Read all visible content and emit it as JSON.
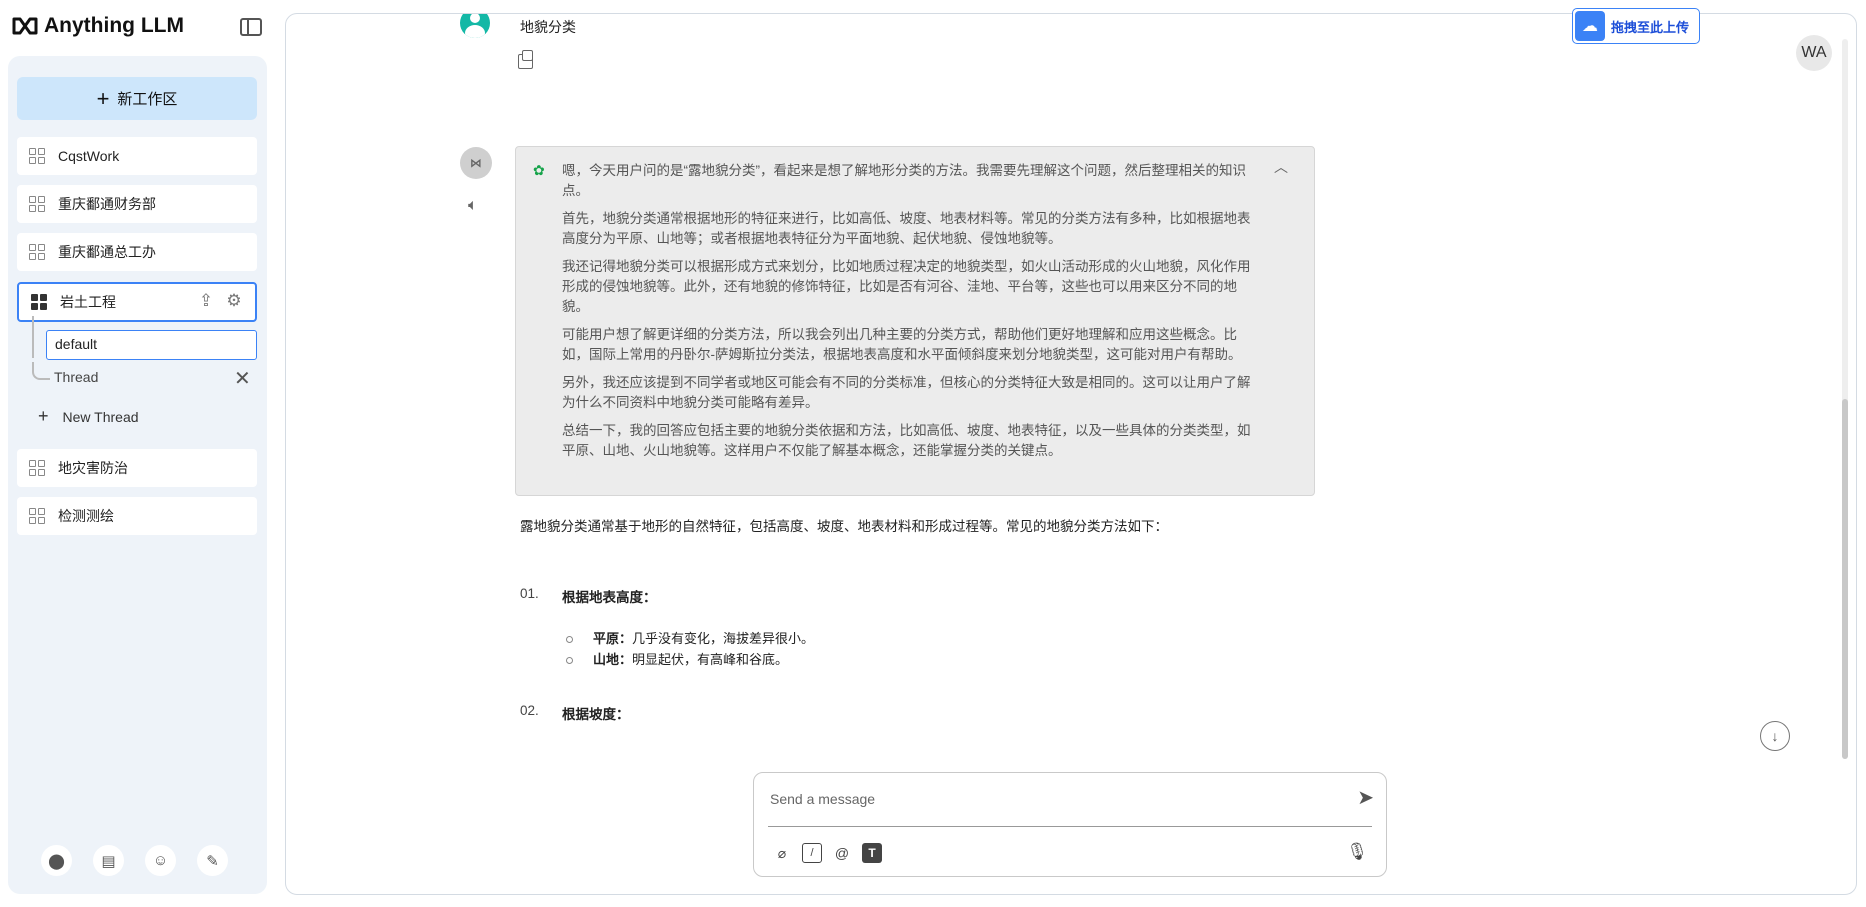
{
  "brand": {
    "name": "Anything LLM"
  },
  "sidebar": {
    "new_workspace_label": "新工作区",
    "workspaces": [
      {
        "label": "CqstWork"
      },
      {
        "label": "重庆鄱通财务部"
      },
      {
        "label": "重庆鄱通总工办"
      },
      {
        "label": "岩土工程"
      },
      {
        "label": "地灾害防治"
      },
      {
        "label": "检测测绘"
      }
    ],
    "threads": {
      "default_label": "default",
      "thread_label": "Thread",
      "new_thread_label": "New Thread"
    }
  },
  "chat": {
    "user_message": "地貌分类",
    "thinking": [
      "嗯，今天用户问的是“露地貌分类”，看起来是想了解地形分类的方法。我需要先理解这个问题，然后整理相关的知识点。",
      "首先，地貌分类通常根据地形的特征来进行，比如高低、坡度、地表材料等。常见的分类方法有多种，比如根据地表高度分为平原、山地等；或者根据地表特征分为平面地貌、起伏地貌、侵蚀地貌等。",
      "我还记得地貌分类可以根据形成方式来划分，比如地质过程决定的地貌类型，如火山活动形成的火山地貌，风化作用形成的侵蚀地貌等。此外，还有地貌的修饰特征，比如是否有河谷、洼地、平台等，这些也可以用来区分不同的地貌。",
      "可能用户想了解更详细的分类方法，所以我会列出几种主要的分类方式，帮助他们更好地理解和应用这些概念。比如，国际上常用的丹卧尔-萨姆斯拉分类法，根据地表高度和水平面倾斜度来划分地貌类型，这可能对用户有帮助。",
      "另外，我还应该提到不同学者或地区可能会有不同的分类标准，但核心的分类特征大致是相同的。这可以让用户了解为什么不同资料中地貌分类可能略有差异。",
      "总结一下，我的回答应包括主要的地貌分类依据和方法，比如高低、坡度、地表特征，以及一些具体的分类类型，如平原、山地、火山地貌等。这样用户不仅能了解基本概念，还能掌握分类的关键点。"
    ],
    "answer_intro": "露地貌分类通常基于地形的自然特征，包括高度、坡度、地表材料和形成过程等。常见的地貌分类方法如下：",
    "list": [
      {
        "num": "01.",
        "heading": "根据地表高度：",
        "bullets": [
          {
            "term": "平原：",
            "text": "几乎没有变化，海拔差异很小。"
          },
          {
            "term": "山地：",
            "text": "明显起伏，有高峰和谷底。"
          }
        ]
      },
      {
        "num": "02.",
        "heading": "根据坡度："
      }
    ]
  },
  "upload_badge": {
    "label": "拖拽至此上传"
  },
  "user_initials": "WA",
  "composer": {
    "placeholder": "Send a message"
  },
  "colors": {
    "accent": "#3b82f6",
    "sidebar_bg": "#eef3f9",
    "new_ws_bg": "#cde6fb"
  }
}
